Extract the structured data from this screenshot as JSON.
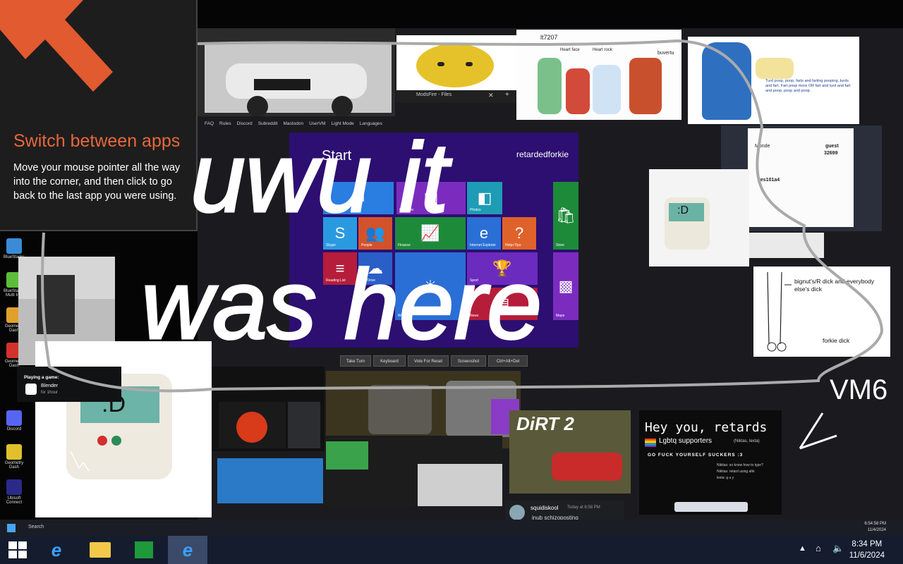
{
  "tip": {
    "heading": "Switch between apps",
    "body": "Move your mouse pointer all the way into the corner, and then click to go back to the last app you were using."
  },
  "browser_strip": {
    "tab_label": "ModsFire - Files",
    "nav_items": [
      "FAQ",
      "Rules",
      "Discord",
      "Subreddit",
      "Mastodon",
      "UserVM",
      "Light Mode",
      "Languages"
    ]
  },
  "win8": {
    "title": "Start",
    "user": "retardedforkie",
    "tiles": [
      {
        "label": "Mail",
        "color": "#2a7de1",
        "icon": "mail-icon"
      },
      {
        "label": "Calendar",
        "color": "#7b2cbf",
        "icon": "calendar-icon"
      },
      {
        "label": "Photos",
        "color": "#1e9bb5",
        "icon": "photos-icon"
      },
      {
        "label": "Skype",
        "color": "#2a9ae0",
        "icon": "skype-icon"
      },
      {
        "label": "People",
        "color": "#d2522b",
        "icon": "people-icon"
      },
      {
        "label": "Finance",
        "color": "#1d8a3a",
        "icon": "finance-icon"
      },
      {
        "label": "Internet Explorer",
        "color": "#2a6fd6",
        "icon": "ie-icon"
      },
      {
        "label": "Help+Tips",
        "color": "#e0622b",
        "icon": "help-icon"
      },
      {
        "label": "Reading List",
        "color": "#b51d3a",
        "icon": "reading-icon"
      },
      {
        "label": "SkyDrive",
        "color": "#2a5fc7",
        "icon": "cloud-icon"
      },
      {
        "label": "Weather",
        "color": "#2a6fd6",
        "icon": "sun-icon"
      },
      {
        "label": "Sport",
        "color": "#6c2bbf",
        "icon": "trophy-icon"
      },
      {
        "label": "News",
        "color": "#b51d3a",
        "icon": "news-icon"
      },
      {
        "label": "Store",
        "color": "#1d8a3a",
        "icon": "store-icon"
      },
      {
        "label": "Maps",
        "color": "#7b2cbf",
        "icon": "maps-icon"
      }
    ]
  },
  "vm_toolbar": {
    "take_turn": "Take Turn",
    "keyboard": "Keyboard",
    "vote_reset": "Vote For Reset",
    "screenshot": "Screenshot",
    "ctrl_alt_del": "Ctrl+Alt+Del"
  },
  "drawing": {
    "line1": "uwu it",
    "line2": "was here",
    "signature": "VM6"
  },
  "comic": {
    "label1": "Heart face",
    "label2": "Heart rock",
    "username": "buvertu",
    "id": "lt7207"
  },
  "cat_note": {
    "text": "Turd poop, poop, farts and farting pooping, turds and fart. Fart poop more OR fart and turd and fart and poop, poop and poop."
  },
  "sketch": {
    "label1": "Monde",
    "label2": "guest",
    "label3": "32699",
    "label4": "yes101a4"
  },
  "whiteboard": {
    "note1": "bignut's/R dick and everybody else's dick",
    "note2": "forkie dick"
  },
  "overlay": {
    "playing_label": "Playing a game:",
    "game_name": "Blender",
    "game_time": "for 1hour"
  },
  "desktop_icons": [
    {
      "label": "BlueStacks",
      "color": "#3a8bd6"
    },
    {
      "label": "BlueStacks Multi Ins.",
      "color": "#5bbd3a"
    },
    {
      "label": "Geometry Dash",
      "color": "#e0a02b"
    },
    {
      "label": "Geometry Dash",
      "color": "#d2322b"
    },
    {
      "label": "Discord",
      "color": "#5865f2"
    },
    {
      "label": "Geometry Dash",
      "color": "#e0c02b"
    },
    {
      "label": "Ubisoft Connect",
      "color": "#2a2a8a"
    }
  ],
  "chat_bottom": {
    "name": "squidiskool",
    "time": "Today at 6:58 PM",
    "message": "inub schizoposting"
  },
  "dirt_game": {
    "title": "DiRT 2"
  },
  "meme_post": {
    "title": "Hey you, retards",
    "subtitle": "Lgbtq supporters",
    "subtitle_small": "(Niktas, lexta)",
    "banner": "GO FUCK YOURSELF SUCKERS :3",
    "lines": [
      "Nikitas: so know how to type?",
      "Nikitas: retard using ahk",
      "lexta: g u y"
    ]
  },
  "inner_taskbar": {
    "search": "Search",
    "time": "6:54:58 PM",
    "date": "11/4/2024"
  },
  "taskbar": {
    "time": "8:34 PM",
    "date": "11/6/2024",
    "apps": [
      {
        "name": "ie-icon",
        "active": false
      },
      {
        "name": "file-explorer-icon",
        "active": false
      },
      {
        "name": "store-icon",
        "active": false
      },
      {
        "name": "ie-icon",
        "active": true
      }
    ]
  },
  "colors": {
    "win8_bg": "#2c0f70",
    "accent_orange": "#e8673c",
    "taskbar": "#141c2e"
  }
}
